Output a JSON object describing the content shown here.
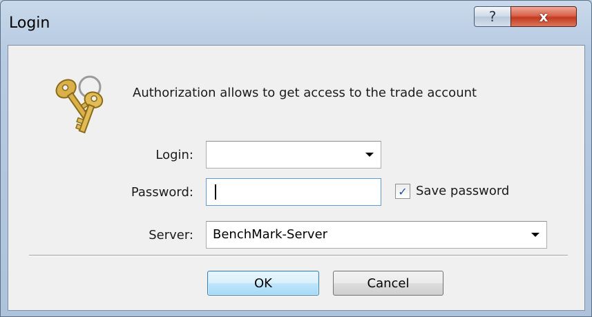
{
  "window": {
    "title": "Login"
  },
  "titlebar": {
    "help_glyph": "?",
    "close_glyph": "x"
  },
  "header": {
    "icon": "keys-icon",
    "message": "Authorization allows to get access to the trade account"
  },
  "form": {
    "login": {
      "label": "Login:",
      "value": ""
    },
    "password": {
      "label": "Password:",
      "value": ""
    },
    "save_password": {
      "label": "Save password",
      "checked": true,
      "check_glyph": "✓"
    },
    "server": {
      "label": "Server:",
      "value": "BenchMark-Server"
    }
  },
  "buttons": {
    "ok": "OK",
    "cancel": "Cancel"
  },
  "colors": {
    "title_bg": "#b7cbe2",
    "close_red": "#c33a1f",
    "ok_border": "#3c7fb1",
    "client_bg": "#f0f0f0"
  }
}
